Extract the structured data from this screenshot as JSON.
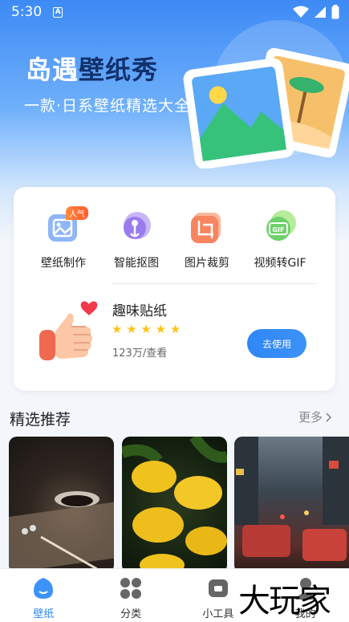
{
  "status": {
    "time": "5:30",
    "notif_icon": "A"
  },
  "hero": {
    "title_part1": "岛遇",
    "title_part2": "壁纸秀",
    "subtitle": "一款·日系壁纸精选大全"
  },
  "tools": [
    {
      "label": "壁纸制作",
      "badge": "人气",
      "icon": "image-edit-icon"
    },
    {
      "label": "智能抠图",
      "icon": "smart-cutout-icon"
    },
    {
      "label": "图片裁剪",
      "icon": "crop-icon"
    },
    {
      "label": "视频转GIF",
      "icon": "gif-icon",
      "gif_text": "GIF"
    }
  ],
  "sticker": {
    "title": "趣味贴纸",
    "stars": "★ ★ ★ ★ ★",
    "views": "123万/查看",
    "button": "去使用"
  },
  "featured": {
    "title": "精选推荐",
    "more": "更多"
  },
  "tabs": [
    {
      "label": "壁纸",
      "active": true
    },
    {
      "label": "分类"
    },
    {
      "label": "小工具"
    },
    {
      "label": "我的"
    }
  ],
  "watermark": "大玩家",
  "colors": {
    "accent": "#2f86f6",
    "star": "#ffc21a",
    "hero_top": "#3d8af5"
  }
}
